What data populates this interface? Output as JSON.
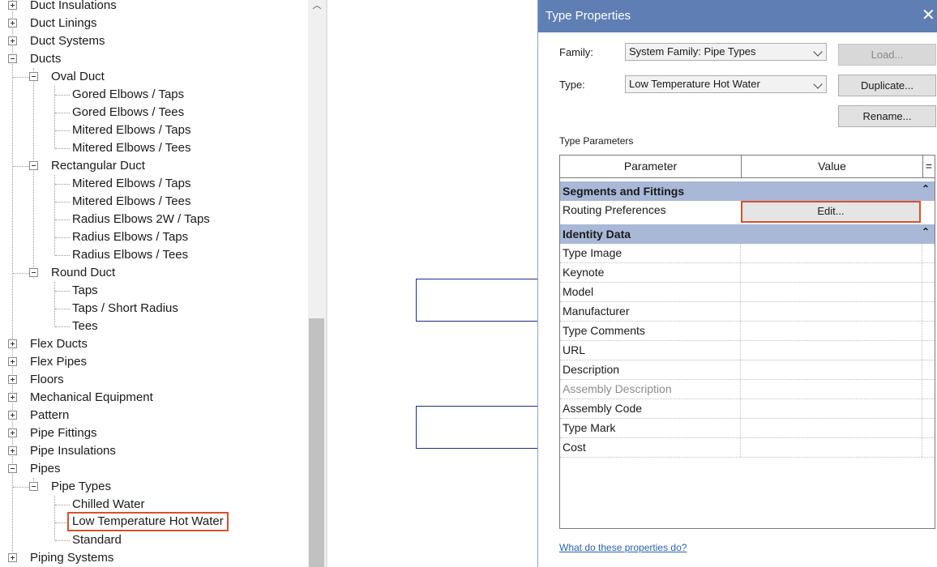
{
  "tree": {
    "items": [
      {
        "label": "Duct Insulations"
      },
      {
        "label": "Duct Linings"
      },
      {
        "label": "Duct Systems"
      },
      {
        "label": "Ducts"
      },
      {
        "label": "Oval Duct"
      },
      {
        "label": "Gored Elbows / Taps"
      },
      {
        "label": "Gored Elbows / Tees"
      },
      {
        "label": "Mitered Elbows / Taps"
      },
      {
        "label": "Mitered Elbows / Tees"
      },
      {
        "label": "Rectangular Duct"
      },
      {
        "label": "Mitered Elbows / Taps"
      },
      {
        "label": "Mitered Elbows / Tees"
      },
      {
        "label": "Radius Elbows 2W / Taps"
      },
      {
        "label": "Radius Elbows / Taps"
      },
      {
        "label": "Radius Elbows / Tees"
      },
      {
        "label": "Round Duct"
      },
      {
        "label": "Taps"
      },
      {
        "label": "Taps / Short Radius"
      },
      {
        "label": "Tees"
      },
      {
        "label": "Flex Ducts"
      },
      {
        "label": "Flex Pipes"
      },
      {
        "label": "Floors"
      },
      {
        "label": "Mechanical Equipment"
      },
      {
        "label": "Pattern"
      },
      {
        "label": "Pipe Fittings"
      },
      {
        "label": "Pipe Insulations"
      },
      {
        "label": "Pipes"
      },
      {
        "label": "Pipe Types"
      },
      {
        "label": "Chilled Water"
      },
      {
        "label": "Low Temperature Hot Water"
      },
      {
        "label": "Standard"
      },
      {
        "label": "Piping Systems"
      }
    ]
  },
  "dialog": {
    "title": "Type Properties",
    "close_glyph": "✕",
    "family_label": "Family:",
    "family_value": "System Family: Pipe Types",
    "type_label": "Type:",
    "type_value": "Low Temperature Hot Water",
    "load_label": "Load...",
    "duplicate_label": "Duplicate...",
    "rename_label": "Rename...",
    "type_parameters_label": "Type Parameters",
    "grid": {
      "col_parameter": "Parameter",
      "col_value": "Value",
      "col_eq": "=",
      "groups": [
        {
          "name": "Segments and Fittings",
          "collapse_glyph": "⌃"
        },
        {
          "name": "Identity Data",
          "collapse_glyph": "⌃"
        }
      ],
      "routing_label": "Routing Preferences",
      "edit_label": "Edit...",
      "identity_rows": [
        {
          "param": "Type Image"
        },
        {
          "param": "Keynote"
        },
        {
          "param": "Model"
        },
        {
          "param": "Manufacturer"
        },
        {
          "param": "Type Comments"
        },
        {
          "param": "URL"
        },
        {
          "param": "Description"
        },
        {
          "param": "Assembly Description"
        },
        {
          "param": "Assembly Code"
        },
        {
          "param": "Type Mark"
        },
        {
          "param": "Cost"
        }
      ]
    },
    "help_link": "What do these properties do?"
  },
  "colors": {
    "titlebar": "#5f7fb4",
    "group_header": "#a9b8d7",
    "highlight": "#d9512c",
    "link": "#2a5fb4"
  }
}
